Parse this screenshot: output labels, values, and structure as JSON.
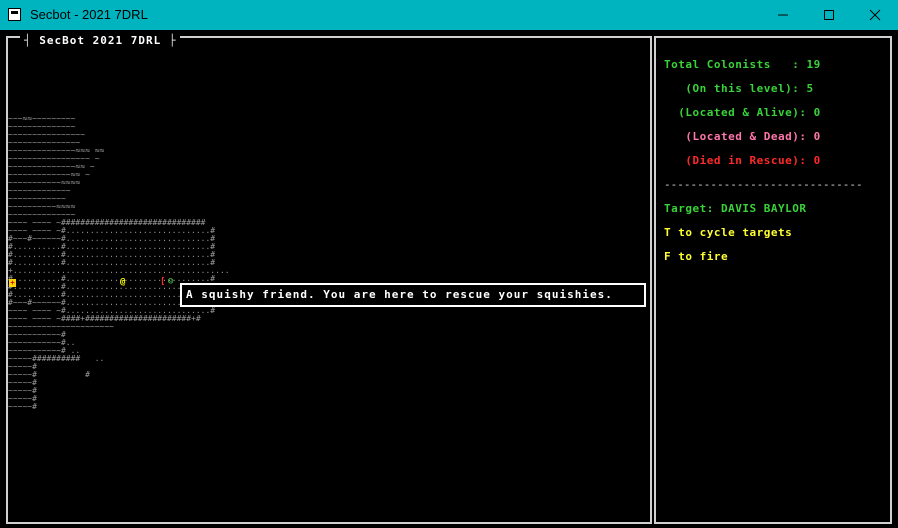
{
  "window": {
    "title": "Secbot - 2021 7DRL",
    "minimize_icon": "minimize-icon",
    "maximize_icon": "maximize-icon",
    "close_icon": "close-icon"
  },
  "map_panel": {
    "title": "SecBot 2021 7DRL"
  },
  "map_rows": [
    "~~~≈≈~~~~~~~~~",
    "~~~~~~~~~~~~~~",
    "~~~~~~~~~~~~~~~~",
    "~~~~~~~~~~~~~~~",
    "~~~~~~~~~~~~~~≈≈≈ ≈≈",
    "~~~~~~~~~~~~~~~~~ ~",
    "~~~~~~~~~~~~~~≈≈ ~",
    "~~~~~~~~~~~~~≈≈ ~",
    "~~~~~~~~~~~≈≈≈≈",
    "~~~~~~~~~~~~~",
    "~~~~~~~~~~~~",
    "~~~~~~~~~~≈≈≈≈",
    "~~~~~~~~~~~~~~",
    "~~~~ ~~~~ ~##############################",
    "~~~~ ~~~~ ~#..............................#",
    "#~~~#~~~~~~#..............................#",
    "#..........#..............................#",
    "#..........#..............................#",
    "#..........#..............................#",
    "+.............................................",
    "#..........#..............................#",
    "#..........#..............................#",
    "#..........#..............................#",
    "#~~~#~~~~~~#..............................#",
    "~~~~ ~~~~ ~#..............................#",
    "~~~~ ~~~~ ~####+######################+#",
    "~~~~~~~~~~~~~~~~~~~~~~",
    "~~~~~~~~~~~#",
    "~~~~~~~~~~~#..",
    "~~~~~~~~~~~# ..",
    "~~~~~##########   ..",
    "~~~~~#",
    "~~~~~#          #",
    "~~~~~#",
    "~~~~~#",
    "~~~~~#",
    "~~~~~#"
  ],
  "tooltip": {
    "text": "A squishy friend. You are here to rescue your squishies."
  },
  "stats": {
    "total": "Total Colonists   : 19",
    "on_level": "   (On this level): 5",
    "located_alive": "  (Located & Alive): 0",
    "located_dead": "   (Located & Dead): 0",
    "died_rescue": "   (Died in Rescue): 0",
    "divider": "------------------------------",
    "target": "Target: DAVIS BAYLOR",
    "hint_cycle": "T to cycle targets",
    "hint_fire": "F to fire"
  },
  "colors": {
    "titlebar": "#00b4bf",
    "green": "#39d339",
    "pink": "#ff77aa",
    "red": "#ff2a2a",
    "yellow": "#ffff33"
  },
  "glyphs": {
    "player": "@",
    "friend": "☺",
    "door": "[",
    "item": "+"
  }
}
